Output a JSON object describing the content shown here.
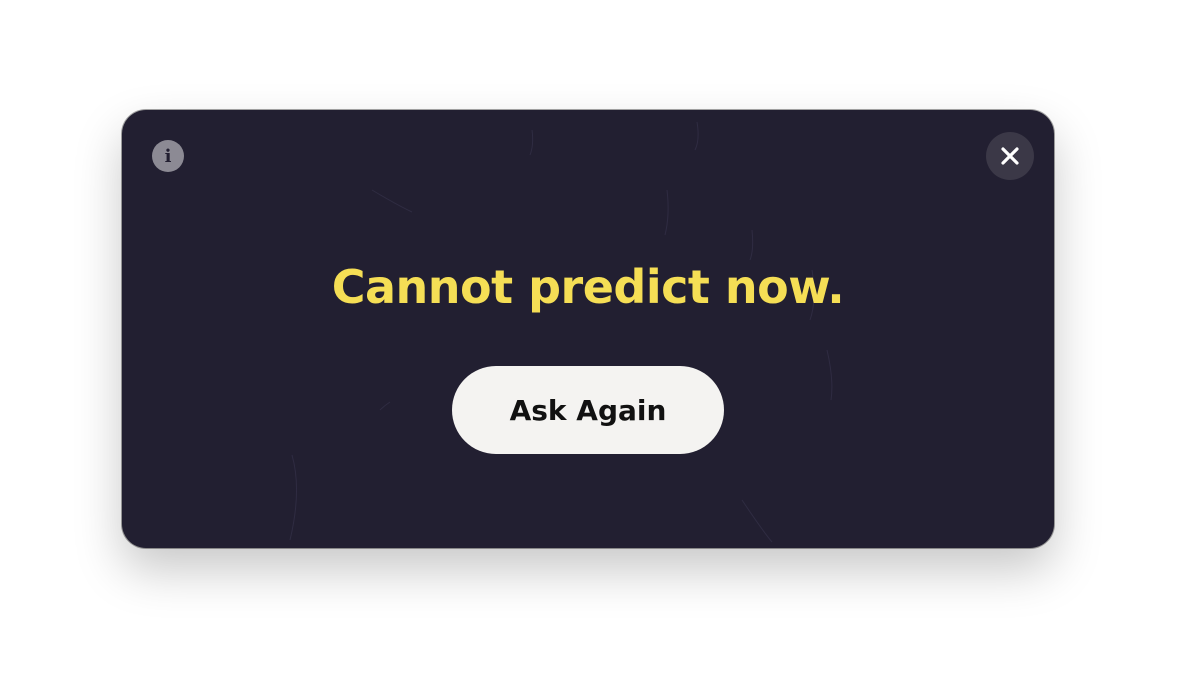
{
  "dialog": {
    "answer_text": "Cannot predict now.",
    "ask_again_label": "Ask Again",
    "info_glyph": "i",
    "info_icon": "info-icon",
    "close_icon": "close-icon"
  },
  "colors": {
    "panel_background": "#221f31",
    "answer_text": "#f5de55",
    "button_background": "#f4f3f1",
    "button_text": "#111111",
    "close_button_background": "#3b3847",
    "info_icon_background": "#8c8a94"
  }
}
